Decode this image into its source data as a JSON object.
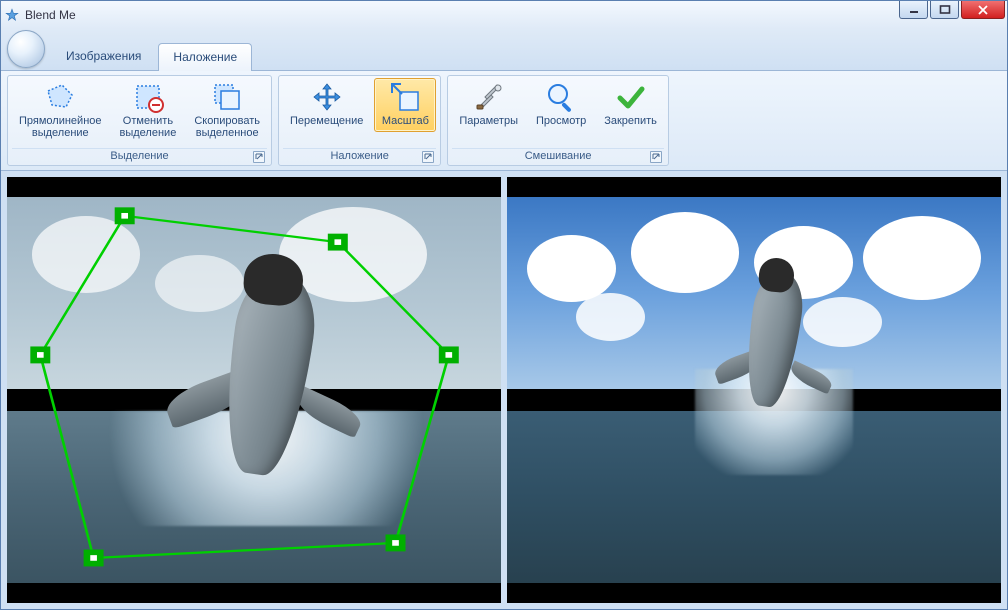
{
  "window": {
    "title": "Blend Me"
  },
  "tabs": {
    "images": "Изображения",
    "overlay": "Наложение"
  },
  "ribbon": {
    "selection": {
      "title": "Выделение",
      "rectilinear": "Прямолинейное\nвыделение",
      "cancel": "Отменить\nвыделение",
      "copy": "Скопировать\nвыделенное"
    },
    "overlay": {
      "title": "Наложение",
      "move": "Перемещение",
      "scale": "Масштаб"
    },
    "blending": {
      "title": "Смешивание",
      "params": "Параметры",
      "preview": "Просмотр",
      "apply": "Закрепить"
    }
  }
}
